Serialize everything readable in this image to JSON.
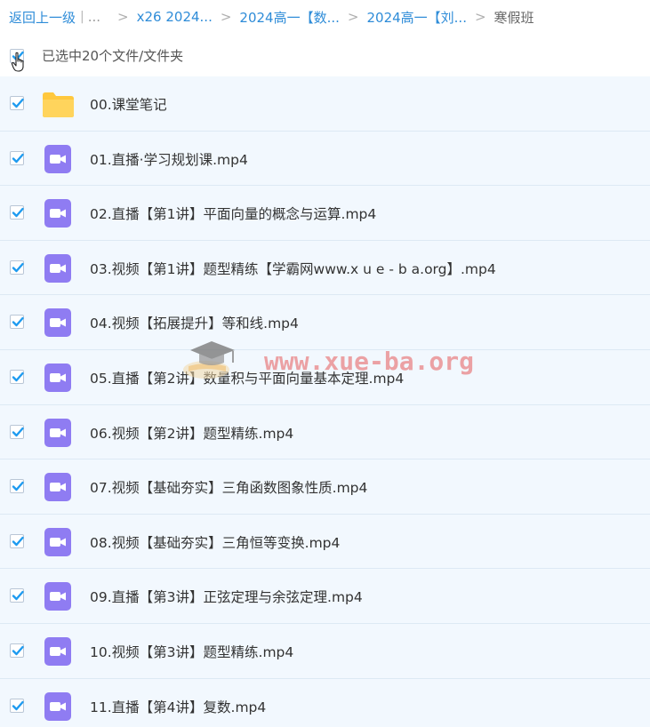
{
  "breadcrumb": {
    "back_label": "返回上一级",
    "separator_bar": "|",
    "ellipsis": "...",
    "items": [
      "x26 2024...",
      "2024高一【数...",
      "2024高一【刘...",
      "寒假班"
    ],
    "arrow": ">"
  },
  "selection": {
    "summary": "已选中20个文件/文件夹",
    "all_checked": true
  },
  "watermark": {
    "text": "www.xue-ba.org"
  },
  "colors": {
    "link": "#2e8cd8",
    "checkbox_tick": "#1e9bf0",
    "video_icon": "#8f7cf2",
    "folder_icon": "#ffc83d",
    "row_selected_bg": "#f2f8fe"
  },
  "files": [
    {
      "type": "folder",
      "name": "00.课堂笔记",
      "checked": true,
      "icon": "folder-icon"
    },
    {
      "type": "video",
      "name": "01.直播·学习规划课.mp4",
      "checked": true,
      "icon": "video-icon"
    },
    {
      "type": "video",
      "name": "02.直播【第1讲】平面向量的概念与运算.mp4",
      "checked": true,
      "icon": "video-icon"
    },
    {
      "type": "video",
      "name": "03.视频【第1讲】题型精练【学霸网www.x u e - b a.org】.mp4",
      "checked": true,
      "icon": "video-icon"
    },
    {
      "type": "video",
      "name": "04.视频【拓展提升】等和线.mp4",
      "checked": true,
      "icon": "video-icon"
    },
    {
      "type": "video",
      "name": "05.直播【第2讲】数量积与平面向量基本定理.mp4",
      "checked": true,
      "icon": "video-icon"
    },
    {
      "type": "video",
      "name": "06.视频【第2讲】题型精练.mp4",
      "checked": true,
      "icon": "video-icon"
    },
    {
      "type": "video",
      "name": "07.视频【基础夯实】三角函数图象性质.mp4",
      "checked": true,
      "icon": "video-icon"
    },
    {
      "type": "video",
      "name": "08.视频【基础夯实】三角恒等变换.mp4",
      "checked": true,
      "icon": "video-icon"
    },
    {
      "type": "video",
      "name": "09.直播【第3讲】正弦定理与余弦定理.mp4",
      "checked": true,
      "icon": "video-icon"
    },
    {
      "type": "video",
      "name": "10.视频【第3讲】题型精练.mp4",
      "checked": true,
      "icon": "video-icon"
    },
    {
      "type": "video",
      "name": "11.直播【第4讲】复数.mp4",
      "checked": true,
      "icon": "video-icon"
    }
  ]
}
